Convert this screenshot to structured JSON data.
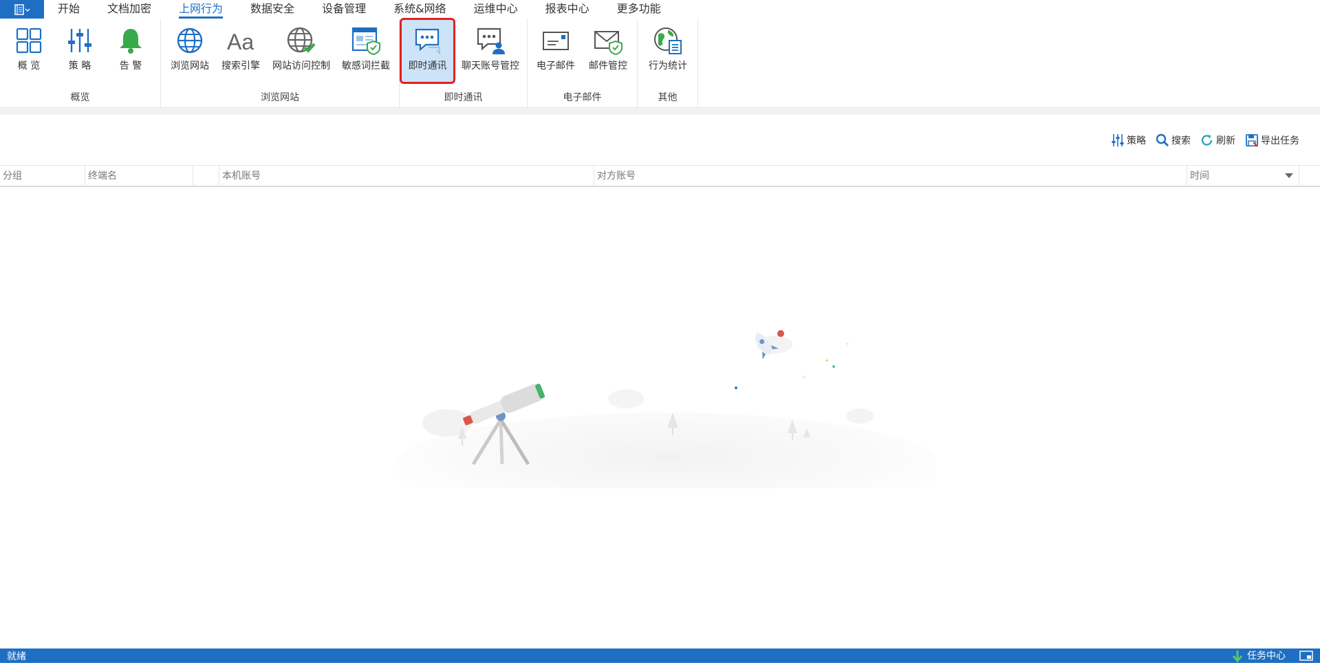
{
  "menu": {
    "tabs": [
      {
        "label": "开始"
      },
      {
        "label": "文档加密"
      },
      {
        "label": "上网行为"
      },
      {
        "label": "数据安全"
      },
      {
        "label": "设备管理"
      },
      {
        "label": "系统&网络"
      },
      {
        "label": "运维中心"
      },
      {
        "label": "报表中心"
      },
      {
        "label": "更多功能"
      }
    ],
    "active": "上网行为"
  },
  "ribbon": {
    "groups": [
      {
        "label": "概览",
        "buttons": [
          {
            "label": "概 览"
          },
          {
            "label": "策 略"
          },
          {
            "label": "告 警"
          }
        ]
      },
      {
        "label": "浏览网站",
        "buttons": [
          {
            "label": "浏览网站"
          },
          {
            "label": "搜索引擎"
          },
          {
            "label": "网站访问控制"
          },
          {
            "label": "敏感词拦截"
          }
        ]
      },
      {
        "label": "即时通讯",
        "buttons": [
          {
            "label": "即时通讯"
          },
          {
            "label": "聊天账号管控"
          }
        ]
      },
      {
        "label": "电子邮件",
        "buttons": [
          {
            "label": "电子邮件"
          },
          {
            "label": "邮件管控"
          }
        ]
      },
      {
        "label": "其他",
        "buttons": [
          {
            "label": "行为统计"
          }
        ]
      }
    ]
  },
  "toolbar": {
    "policy": "策略",
    "search": "搜索",
    "refresh": "刷新",
    "export": "导出任务"
  },
  "table": {
    "columns": [
      {
        "label": "分组"
      },
      {
        "label": "终端名"
      },
      {
        "label": ""
      },
      {
        "label": "本机账号"
      },
      {
        "label": "对方账号"
      },
      {
        "label": "时间"
      }
    ]
  },
  "statusbar": {
    "text": "就绪",
    "task_center": "任务中心"
  },
  "colors": {
    "brand": "#1e6fc3",
    "selected": "#cde3f7",
    "highlight": "#e02020",
    "green": "#3aa94a"
  }
}
